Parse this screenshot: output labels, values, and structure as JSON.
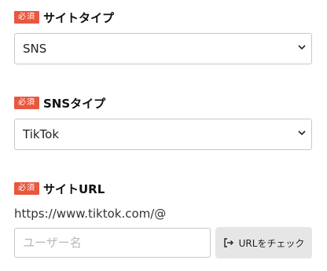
{
  "site_type": {
    "required_badge": "必須",
    "label": "サイトタイプ",
    "selected": "SNS"
  },
  "sns_type": {
    "required_badge": "必須",
    "label": "SNSタイプ",
    "selected": "TikTok"
  },
  "site_url": {
    "required_badge": "必須",
    "label": "サイトURL",
    "prefix": "https://www.tiktok.com/@",
    "username_placeholder": "ユーザー名",
    "username_value": "",
    "check_button_label": "URLをチェック"
  },
  "colors": {
    "required_badge_bg": "#e8573f",
    "button_bg": "#e6e6e6",
    "border": "#c8c8c8"
  },
  "icons": {
    "select_chevron": "chevron-down-icon",
    "check_button": "login-arrow-icon"
  }
}
